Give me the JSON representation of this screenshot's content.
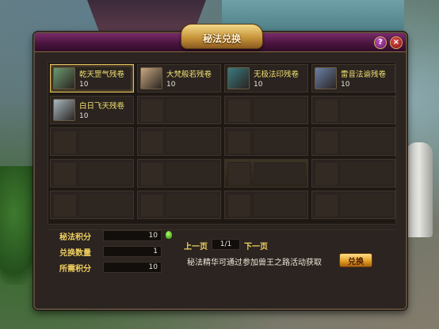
{
  "window": {
    "title": "秘法兑换"
  },
  "header_buttons": {
    "help": "?",
    "close": "×"
  },
  "items": [
    {
      "name": "乾天罡气残卷",
      "count": "10",
      "icon": "scroll-spring-icon",
      "color": "#6a9a70"
    },
    {
      "name": "大梵般若残卷",
      "count": "10",
      "icon": "scroll-paper-icon",
      "color": "#c8a880"
    },
    {
      "name": "无极法印残卷",
      "count": "10",
      "icon": "book-teal-icon",
      "color": "#3a7a80"
    },
    {
      "name": "雷音法谕残卷",
      "count": "10",
      "icon": "scroll-blue-icon",
      "color": "#6a80a8"
    },
    {
      "name": "白日飞天残卷",
      "count": "10",
      "icon": "book-white-icon",
      "color": "#a8b8c0"
    }
  ],
  "stats": {
    "points_label": "秘法积分",
    "points_value": "10",
    "qty_label": "兑换数量",
    "qty_value": "1",
    "cost_label": "所需积分",
    "cost_value": "10"
  },
  "pager": {
    "prev": "上一页",
    "next": "下一页",
    "indicator": "1/1"
  },
  "hint": "秘法精华可通过参加兽王之路活动获取",
  "exchange_button": "兑换"
}
